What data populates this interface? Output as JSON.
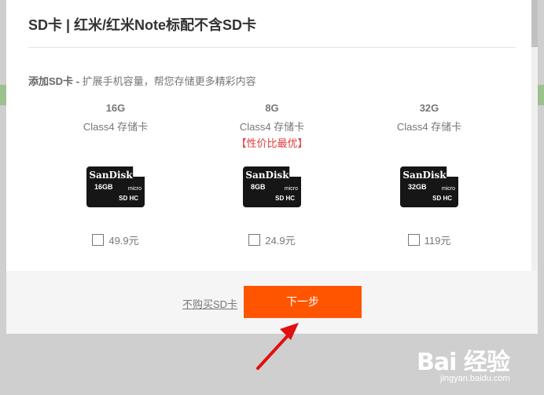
{
  "dialog": {
    "title": "SD卡 | 红米/红米Note标配不含SD卡",
    "subtitle_strong": "添加SD卡 -",
    "subtitle_rest": " 扩展手机容量，帮您存储更多精彩内容"
  },
  "cards": [
    {
      "capacity": "16G",
      "desc": "Class4 存储卡",
      "promo": "",
      "brand": "SanDisk",
      "card_size": "16GB",
      "micro": "micro",
      "hc": "SD HC",
      "price": "49.9元",
      "checked": false
    },
    {
      "capacity": "8G",
      "desc": "Class4 存储卡",
      "promo": "【性价比最优】",
      "brand": "SanDisk",
      "card_size": "8GB",
      "micro": "micro",
      "hc": "SD HC",
      "price": "24.9元",
      "checked": false
    },
    {
      "capacity": "32G",
      "desc": "Class4 存储卡",
      "promo": "",
      "brand": "SanDisk",
      "card_size": "32GB",
      "micro": "micro",
      "hc": "SD HC",
      "price": "119元",
      "checked": false
    }
  ],
  "footer": {
    "skip_label": "不购买SD卡",
    "next_label": "下一步"
  },
  "watermark": {
    "main": "Bai 经验",
    "sub": "jingyan.baidu.com"
  },
  "colors": {
    "accent": "#ff5500",
    "promo": "#e4393c",
    "annotation_arrow": "#e01010"
  }
}
